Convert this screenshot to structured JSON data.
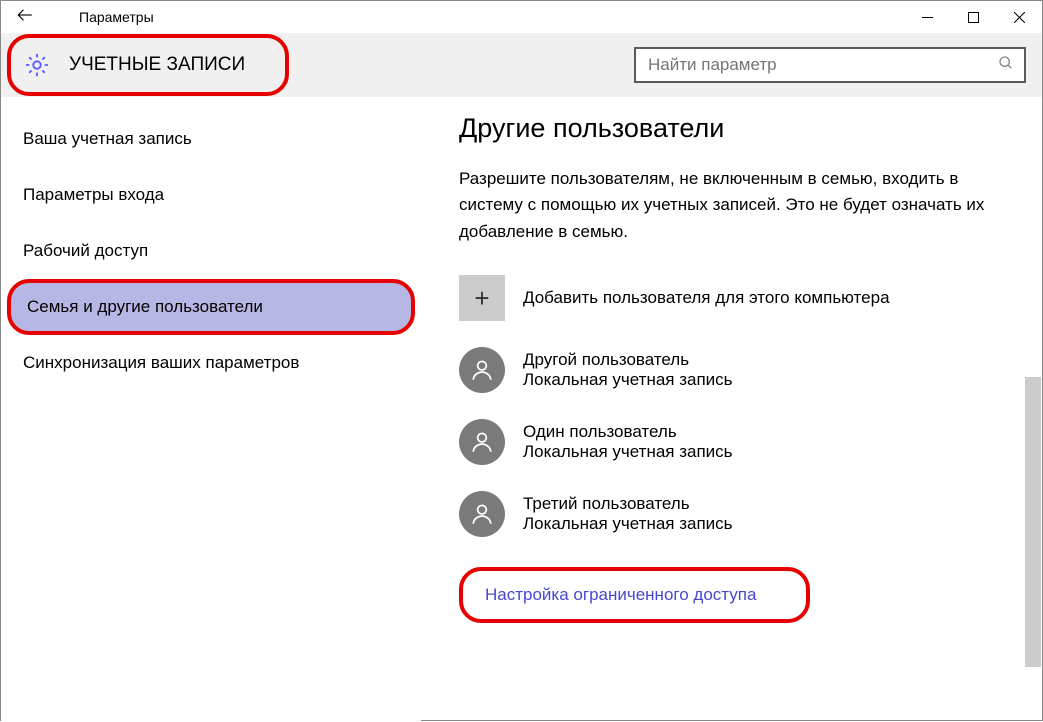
{
  "window": {
    "title": "Параметры"
  },
  "header": {
    "category": "УЧЕТНЫЕ ЗАПИСИ",
    "search_placeholder": "Найти параметр"
  },
  "sidebar": {
    "items": [
      {
        "label": "Ваша учетная запись"
      },
      {
        "label": "Параметры входа"
      },
      {
        "label": "Рабочий доступ"
      },
      {
        "label": "Семья и другие пользователи"
      },
      {
        "label": "Синхронизация ваших параметров"
      }
    ]
  },
  "content": {
    "heading": "Другие пользователи",
    "description": "Разрешите пользователям, не включенным в семью, входить в систему с помощью их учетных записей. Это не будет означать их добавление в семью.",
    "add_user_label": "Добавить пользователя для этого компьютера",
    "users": [
      {
        "name": "Другой пользователь",
        "sub": "Локальная учетная запись"
      },
      {
        "name": "Один пользователь",
        "sub": "Локальная учетная запись"
      },
      {
        "name": "Третий пользователь",
        "sub": "Локальная учетная запись"
      }
    ],
    "restricted_link": "Настройка ограниченного доступа"
  }
}
